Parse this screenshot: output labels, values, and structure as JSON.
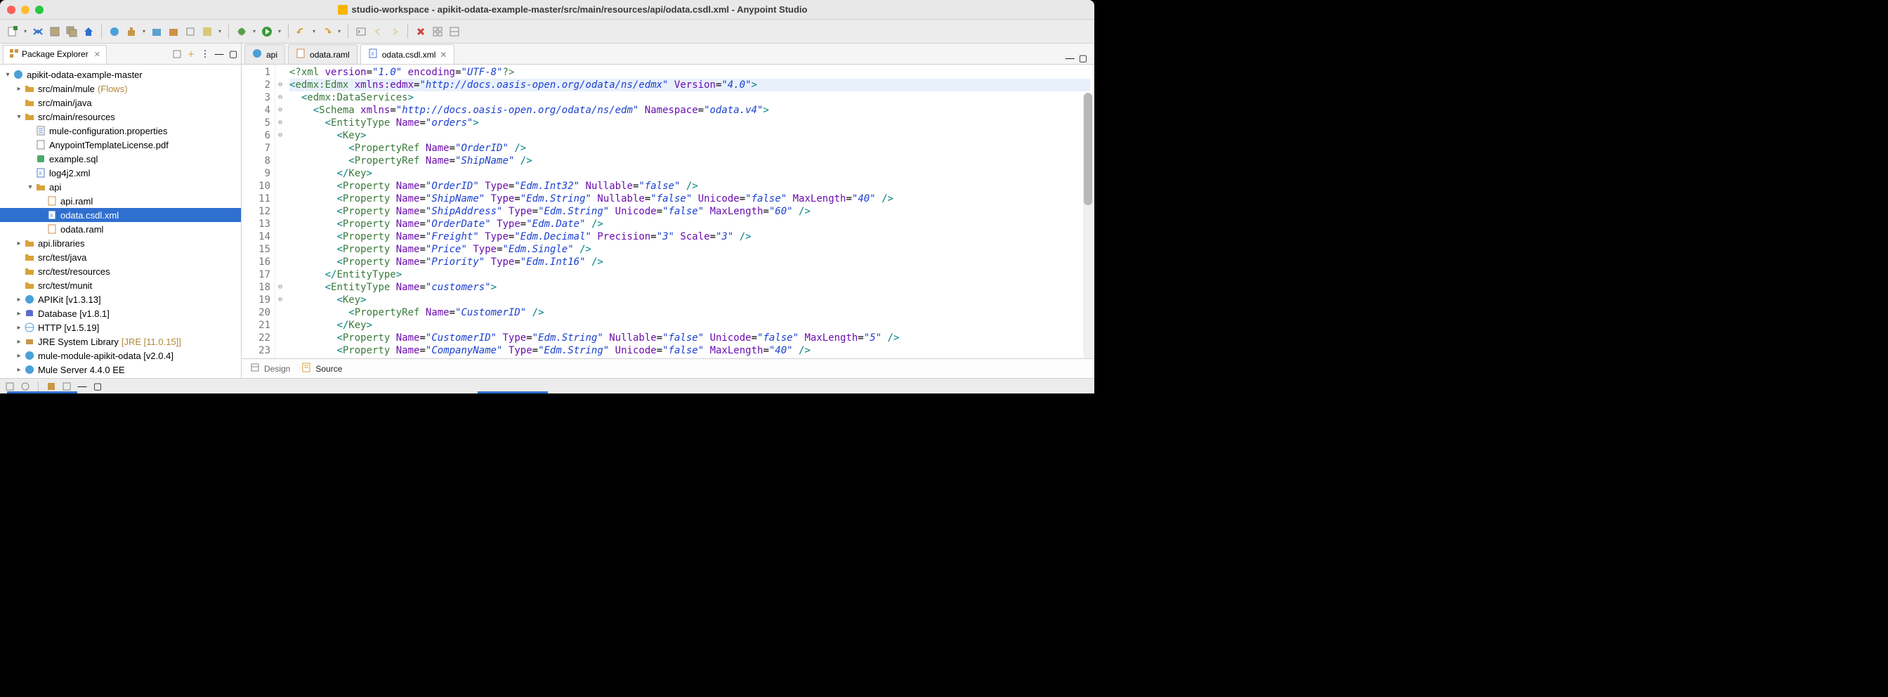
{
  "window": {
    "title": "studio-workspace - apikit-odata-example-master/src/main/resources/api/odata.csdl.xml - Anypoint Studio"
  },
  "packageExplorer": {
    "title": "Package Explorer"
  },
  "tree": {
    "project": "apikit-odata-example-master",
    "srcMainMule": "src/main/mule",
    "srcMainMuleExtra": "(Flows)",
    "srcMainJava": "src/main/java",
    "srcMainResources": "src/main/resources",
    "muleConfig": "mule-configuration.properties",
    "license": "AnypointTemplateLicense.pdf",
    "exampleSql": "example.sql",
    "log4j": "log4j2.xml",
    "api": "api",
    "apiRaml": "api.raml",
    "odataCsdl": "odata.csdl.xml",
    "odataRaml": "odata.raml",
    "apiLibraries": "api.libraries",
    "srcTestJava": "src/test/java",
    "srcTestResources": "src/test/resources",
    "srcTestMunit": "src/test/munit",
    "apikit": "APIKit [v1.3.13]",
    "database": "Database [v1.8.1]",
    "http": "HTTP [v1.5.19]",
    "jre": "JRE System Library",
    "jreExtra": "[JRE [11.0.15]]",
    "muleModule": "mule-module-apikit-odata [v2.0.4]",
    "muleServer": "Mule Server 4.4.0 EE"
  },
  "editorTabs": {
    "t1": "api",
    "t2": "odata.raml",
    "t3": "odata.csdl.xml"
  },
  "bottomTabs": {
    "design": "Design",
    "source": "Source"
  },
  "lineNumbers": [
    "1",
    "2",
    "3",
    "4",
    "5",
    "6",
    "7",
    "8",
    "9",
    "10",
    "11",
    "12",
    "13",
    "14",
    "15",
    "16",
    "17",
    "18",
    "19",
    "20",
    "21",
    "22",
    "23"
  ],
  "foldMarks": [
    "",
    "⊖",
    "⊖",
    "⊖",
    "⊖",
    "⊖",
    "",
    "",
    "",
    "",
    "",
    "",
    "",
    "",
    "",
    "",
    "",
    "⊖",
    "⊖",
    "",
    "",
    "",
    ""
  ],
  "code": [
    [
      {
        "c": "pi",
        "t": "<?xml"
      },
      {
        "c": "",
        "t": " "
      },
      {
        "c": "attr",
        "t": "version"
      },
      {
        "c": "",
        "t": "="
      },
      {
        "c": "str",
        "t": "\"1.0\""
      },
      {
        "c": "",
        "t": " "
      },
      {
        "c": "attr",
        "t": "encoding"
      },
      {
        "c": "",
        "t": "="
      },
      {
        "c": "str",
        "t": "\"UTF-8\""
      },
      {
        "c": "pi",
        "t": "?>"
      }
    ],
    [
      {
        "c": "punct",
        "t": "<"
      },
      {
        "c": "tag",
        "t": "edmx:Edmx"
      },
      {
        "c": "",
        "t": " "
      },
      {
        "c": "attr",
        "t": "xmlns:edmx"
      },
      {
        "c": "",
        "t": "="
      },
      {
        "c": "str",
        "t": "\"http://docs.oasis-open.org/odata/ns/edmx\""
      },
      {
        "c": "",
        "t": " "
      },
      {
        "c": "attr",
        "t": "Version"
      },
      {
        "c": "",
        "t": "="
      },
      {
        "c": "str",
        "t": "\"4.0\""
      },
      {
        "c": "punct",
        "t": ">"
      }
    ],
    [
      {
        "c": "",
        "t": "  "
      },
      {
        "c": "punct",
        "t": "<"
      },
      {
        "c": "tag",
        "t": "edmx:DataServices"
      },
      {
        "c": "punct",
        "t": ">"
      }
    ],
    [
      {
        "c": "",
        "t": "    "
      },
      {
        "c": "punct",
        "t": "<"
      },
      {
        "c": "tag",
        "t": "Schema"
      },
      {
        "c": "",
        "t": " "
      },
      {
        "c": "attr",
        "t": "xmlns"
      },
      {
        "c": "",
        "t": "="
      },
      {
        "c": "str",
        "t": "\"http://docs.oasis-open.org/odata/ns/edm\""
      },
      {
        "c": "",
        "t": " "
      },
      {
        "c": "attr",
        "t": "Namespace"
      },
      {
        "c": "",
        "t": "="
      },
      {
        "c": "str",
        "t": "\"odata.v4\""
      },
      {
        "c": "punct",
        "t": ">"
      }
    ],
    [
      {
        "c": "",
        "t": "      "
      },
      {
        "c": "punct",
        "t": "<"
      },
      {
        "c": "tag",
        "t": "EntityType"
      },
      {
        "c": "",
        "t": " "
      },
      {
        "c": "attr",
        "t": "Name"
      },
      {
        "c": "",
        "t": "="
      },
      {
        "c": "str",
        "t": "\"orders\""
      },
      {
        "c": "punct",
        "t": ">"
      }
    ],
    [
      {
        "c": "",
        "t": "        "
      },
      {
        "c": "punct",
        "t": "<"
      },
      {
        "c": "tag",
        "t": "Key"
      },
      {
        "c": "punct",
        "t": ">"
      }
    ],
    [
      {
        "c": "",
        "t": "          "
      },
      {
        "c": "punct",
        "t": "<"
      },
      {
        "c": "tag",
        "t": "PropertyRef"
      },
      {
        "c": "",
        "t": " "
      },
      {
        "c": "attr",
        "t": "Name"
      },
      {
        "c": "",
        "t": "="
      },
      {
        "c": "str",
        "t": "\"OrderID\""
      },
      {
        "c": "",
        "t": " "
      },
      {
        "c": "punct",
        "t": "/>"
      }
    ],
    [
      {
        "c": "",
        "t": "          "
      },
      {
        "c": "punct",
        "t": "<"
      },
      {
        "c": "tag",
        "t": "PropertyRef"
      },
      {
        "c": "",
        "t": " "
      },
      {
        "c": "attr",
        "t": "Name"
      },
      {
        "c": "",
        "t": "="
      },
      {
        "c": "str",
        "t": "\"ShipName\""
      },
      {
        "c": "",
        "t": " "
      },
      {
        "c": "punct",
        "t": "/>"
      }
    ],
    [
      {
        "c": "",
        "t": "        "
      },
      {
        "c": "punct",
        "t": "</"
      },
      {
        "c": "tag",
        "t": "Key"
      },
      {
        "c": "punct",
        "t": ">"
      }
    ],
    [
      {
        "c": "",
        "t": "        "
      },
      {
        "c": "punct",
        "t": "<"
      },
      {
        "c": "tag",
        "t": "Property"
      },
      {
        "c": "",
        "t": " "
      },
      {
        "c": "attr",
        "t": "Name"
      },
      {
        "c": "",
        "t": "="
      },
      {
        "c": "str",
        "t": "\"OrderID\""
      },
      {
        "c": "",
        "t": " "
      },
      {
        "c": "attr",
        "t": "Type"
      },
      {
        "c": "",
        "t": "="
      },
      {
        "c": "str",
        "t": "\"Edm.Int32\""
      },
      {
        "c": "",
        "t": " "
      },
      {
        "c": "attr",
        "t": "Nullable"
      },
      {
        "c": "",
        "t": "="
      },
      {
        "c": "str",
        "t": "\"false\""
      },
      {
        "c": "",
        "t": " "
      },
      {
        "c": "punct",
        "t": "/>"
      }
    ],
    [
      {
        "c": "",
        "t": "        "
      },
      {
        "c": "punct",
        "t": "<"
      },
      {
        "c": "tag",
        "t": "Property"
      },
      {
        "c": "",
        "t": " "
      },
      {
        "c": "attr",
        "t": "Name"
      },
      {
        "c": "",
        "t": "="
      },
      {
        "c": "str",
        "t": "\"ShipName\""
      },
      {
        "c": "",
        "t": " "
      },
      {
        "c": "attr",
        "t": "Type"
      },
      {
        "c": "",
        "t": "="
      },
      {
        "c": "str",
        "t": "\"Edm.String\""
      },
      {
        "c": "",
        "t": " "
      },
      {
        "c": "attr",
        "t": "Nullable"
      },
      {
        "c": "",
        "t": "="
      },
      {
        "c": "str",
        "t": "\"false\""
      },
      {
        "c": "",
        "t": " "
      },
      {
        "c": "attr",
        "t": "Unicode"
      },
      {
        "c": "",
        "t": "="
      },
      {
        "c": "str",
        "t": "\"false\""
      },
      {
        "c": "",
        "t": " "
      },
      {
        "c": "attr",
        "t": "MaxLength"
      },
      {
        "c": "",
        "t": "="
      },
      {
        "c": "str",
        "t": "\"40\""
      },
      {
        "c": "",
        "t": " "
      },
      {
        "c": "punct",
        "t": "/>"
      }
    ],
    [
      {
        "c": "",
        "t": "        "
      },
      {
        "c": "punct",
        "t": "<"
      },
      {
        "c": "tag",
        "t": "Property"
      },
      {
        "c": "",
        "t": " "
      },
      {
        "c": "attr",
        "t": "Name"
      },
      {
        "c": "",
        "t": "="
      },
      {
        "c": "str",
        "t": "\"ShipAddress\""
      },
      {
        "c": "",
        "t": " "
      },
      {
        "c": "attr",
        "t": "Type"
      },
      {
        "c": "",
        "t": "="
      },
      {
        "c": "str",
        "t": "\"Edm.String\""
      },
      {
        "c": "",
        "t": " "
      },
      {
        "c": "attr",
        "t": "Unicode"
      },
      {
        "c": "",
        "t": "="
      },
      {
        "c": "str",
        "t": "\"false\""
      },
      {
        "c": "",
        "t": " "
      },
      {
        "c": "attr",
        "t": "MaxLength"
      },
      {
        "c": "",
        "t": "="
      },
      {
        "c": "str",
        "t": "\"60\""
      },
      {
        "c": "",
        "t": " "
      },
      {
        "c": "punct",
        "t": "/>"
      }
    ],
    [
      {
        "c": "",
        "t": "        "
      },
      {
        "c": "punct",
        "t": "<"
      },
      {
        "c": "tag",
        "t": "Property"
      },
      {
        "c": "",
        "t": " "
      },
      {
        "c": "attr",
        "t": "Name"
      },
      {
        "c": "",
        "t": "="
      },
      {
        "c": "str",
        "t": "\"OrderDate\""
      },
      {
        "c": "",
        "t": " "
      },
      {
        "c": "attr",
        "t": "Type"
      },
      {
        "c": "",
        "t": "="
      },
      {
        "c": "str",
        "t": "\"Edm.Date\""
      },
      {
        "c": "",
        "t": " "
      },
      {
        "c": "punct",
        "t": "/>"
      }
    ],
    [
      {
        "c": "",
        "t": "        "
      },
      {
        "c": "punct",
        "t": "<"
      },
      {
        "c": "tag",
        "t": "Property"
      },
      {
        "c": "",
        "t": " "
      },
      {
        "c": "attr",
        "t": "Name"
      },
      {
        "c": "",
        "t": "="
      },
      {
        "c": "str",
        "t": "\"Freight\""
      },
      {
        "c": "",
        "t": " "
      },
      {
        "c": "attr",
        "t": "Type"
      },
      {
        "c": "",
        "t": "="
      },
      {
        "c": "str",
        "t": "\"Edm.Decimal\""
      },
      {
        "c": "",
        "t": " "
      },
      {
        "c": "attr",
        "t": "Precision"
      },
      {
        "c": "",
        "t": "="
      },
      {
        "c": "str",
        "t": "\"3\""
      },
      {
        "c": "",
        "t": " "
      },
      {
        "c": "attr",
        "t": "Scale"
      },
      {
        "c": "",
        "t": "="
      },
      {
        "c": "str",
        "t": "\"3\""
      },
      {
        "c": "",
        "t": " "
      },
      {
        "c": "punct",
        "t": "/>"
      }
    ],
    [
      {
        "c": "",
        "t": "        "
      },
      {
        "c": "punct",
        "t": "<"
      },
      {
        "c": "tag",
        "t": "Property"
      },
      {
        "c": "",
        "t": " "
      },
      {
        "c": "attr",
        "t": "Name"
      },
      {
        "c": "",
        "t": "="
      },
      {
        "c": "str",
        "t": "\"Price\""
      },
      {
        "c": "",
        "t": " "
      },
      {
        "c": "attr",
        "t": "Type"
      },
      {
        "c": "",
        "t": "="
      },
      {
        "c": "str",
        "t": "\"Edm.Single\""
      },
      {
        "c": "",
        "t": " "
      },
      {
        "c": "punct",
        "t": "/>"
      }
    ],
    [
      {
        "c": "",
        "t": "        "
      },
      {
        "c": "punct",
        "t": "<"
      },
      {
        "c": "tag",
        "t": "Property"
      },
      {
        "c": "",
        "t": " "
      },
      {
        "c": "attr",
        "t": "Name"
      },
      {
        "c": "",
        "t": "="
      },
      {
        "c": "str",
        "t": "\"Priority\""
      },
      {
        "c": "",
        "t": " "
      },
      {
        "c": "attr",
        "t": "Type"
      },
      {
        "c": "",
        "t": "="
      },
      {
        "c": "str",
        "t": "\"Edm.Int16\""
      },
      {
        "c": "",
        "t": " "
      },
      {
        "c": "punct",
        "t": "/>"
      }
    ],
    [
      {
        "c": "",
        "t": "      "
      },
      {
        "c": "punct",
        "t": "</"
      },
      {
        "c": "tag",
        "t": "EntityType"
      },
      {
        "c": "punct",
        "t": ">"
      }
    ],
    [
      {
        "c": "",
        "t": "      "
      },
      {
        "c": "punct",
        "t": "<"
      },
      {
        "c": "tag",
        "t": "EntityType"
      },
      {
        "c": "",
        "t": " "
      },
      {
        "c": "attr",
        "t": "Name"
      },
      {
        "c": "",
        "t": "="
      },
      {
        "c": "str",
        "t": "\"customers\""
      },
      {
        "c": "punct",
        "t": ">"
      }
    ],
    [
      {
        "c": "",
        "t": "        "
      },
      {
        "c": "punct",
        "t": "<"
      },
      {
        "c": "tag",
        "t": "Key"
      },
      {
        "c": "punct",
        "t": ">"
      }
    ],
    [
      {
        "c": "",
        "t": "          "
      },
      {
        "c": "punct",
        "t": "<"
      },
      {
        "c": "tag",
        "t": "PropertyRef"
      },
      {
        "c": "",
        "t": " "
      },
      {
        "c": "attr",
        "t": "Name"
      },
      {
        "c": "",
        "t": "="
      },
      {
        "c": "str",
        "t": "\"CustomerID\""
      },
      {
        "c": "",
        "t": " "
      },
      {
        "c": "punct",
        "t": "/>"
      }
    ],
    [
      {
        "c": "",
        "t": "        "
      },
      {
        "c": "punct",
        "t": "</"
      },
      {
        "c": "tag",
        "t": "Key"
      },
      {
        "c": "punct",
        "t": ">"
      }
    ],
    [
      {
        "c": "",
        "t": "        "
      },
      {
        "c": "punct",
        "t": "<"
      },
      {
        "c": "tag",
        "t": "Property"
      },
      {
        "c": "",
        "t": " "
      },
      {
        "c": "attr",
        "t": "Name"
      },
      {
        "c": "",
        "t": "="
      },
      {
        "c": "str",
        "t": "\"CustomerID\""
      },
      {
        "c": "",
        "t": " "
      },
      {
        "c": "attr",
        "t": "Type"
      },
      {
        "c": "",
        "t": "="
      },
      {
        "c": "str",
        "t": "\"Edm.String\""
      },
      {
        "c": "",
        "t": " "
      },
      {
        "c": "attr",
        "t": "Nullable"
      },
      {
        "c": "",
        "t": "="
      },
      {
        "c": "str",
        "t": "\"false\""
      },
      {
        "c": "",
        "t": " "
      },
      {
        "c": "attr",
        "t": "Unicode"
      },
      {
        "c": "",
        "t": "="
      },
      {
        "c": "str",
        "t": "\"false\""
      },
      {
        "c": "",
        "t": " "
      },
      {
        "c": "attr",
        "t": "MaxLength"
      },
      {
        "c": "",
        "t": "="
      },
      {
        "c": "str",
        "t": "\"5\""
      },
      {
        "c": "",
        "t": " "
      },
      {
        "c": "punct",
        "t": "/>"
      }
    ],
    [
      {
        "c": "",
        "t": "        "
      },
      {
        "c": "punct",
        "t": "<"
      },
      {
        "c": "tag",
        "t": "Property"
      },
      {
        "c": "",
        "t": " "
      },
      {
        "c": "attr",
        "t": "Name"
      },
      {
        "c": "",
        "t": "="
      },
      {
        "c": "str",
        "t": "\"CompanyName\""
      },
      {
        "c": "",
        "t": " "
      },
      {
        "c": "attr",
        "t": "Type"
      },
      {
        "c": "",
        "t": "="
      },
      {
        "c": "str",
        "t": "\"Edm.String\""
      },
      {
        "c": "",
        "t": " "
      },
      {
        "c": "attr",
        "t": "Unicode"
      },
      {
        "c": "",
        "t": "="
      },
      {
        "c": "str",
        "t": "\"false\""
      },
      {
        "c": "",
        "t": " "
      },
      {
        "c": "attr",
        "t": "MaxLength"
      },
      {
        "c": "",
        "t": "="
      },
      {
        "c": "str",
        "t": "\"40\""
      },
      {
        "c": "",
        "t": " "
      },
      {
        "c": "punct",
        "t": "/>"
      }
    ]
  ]
}
